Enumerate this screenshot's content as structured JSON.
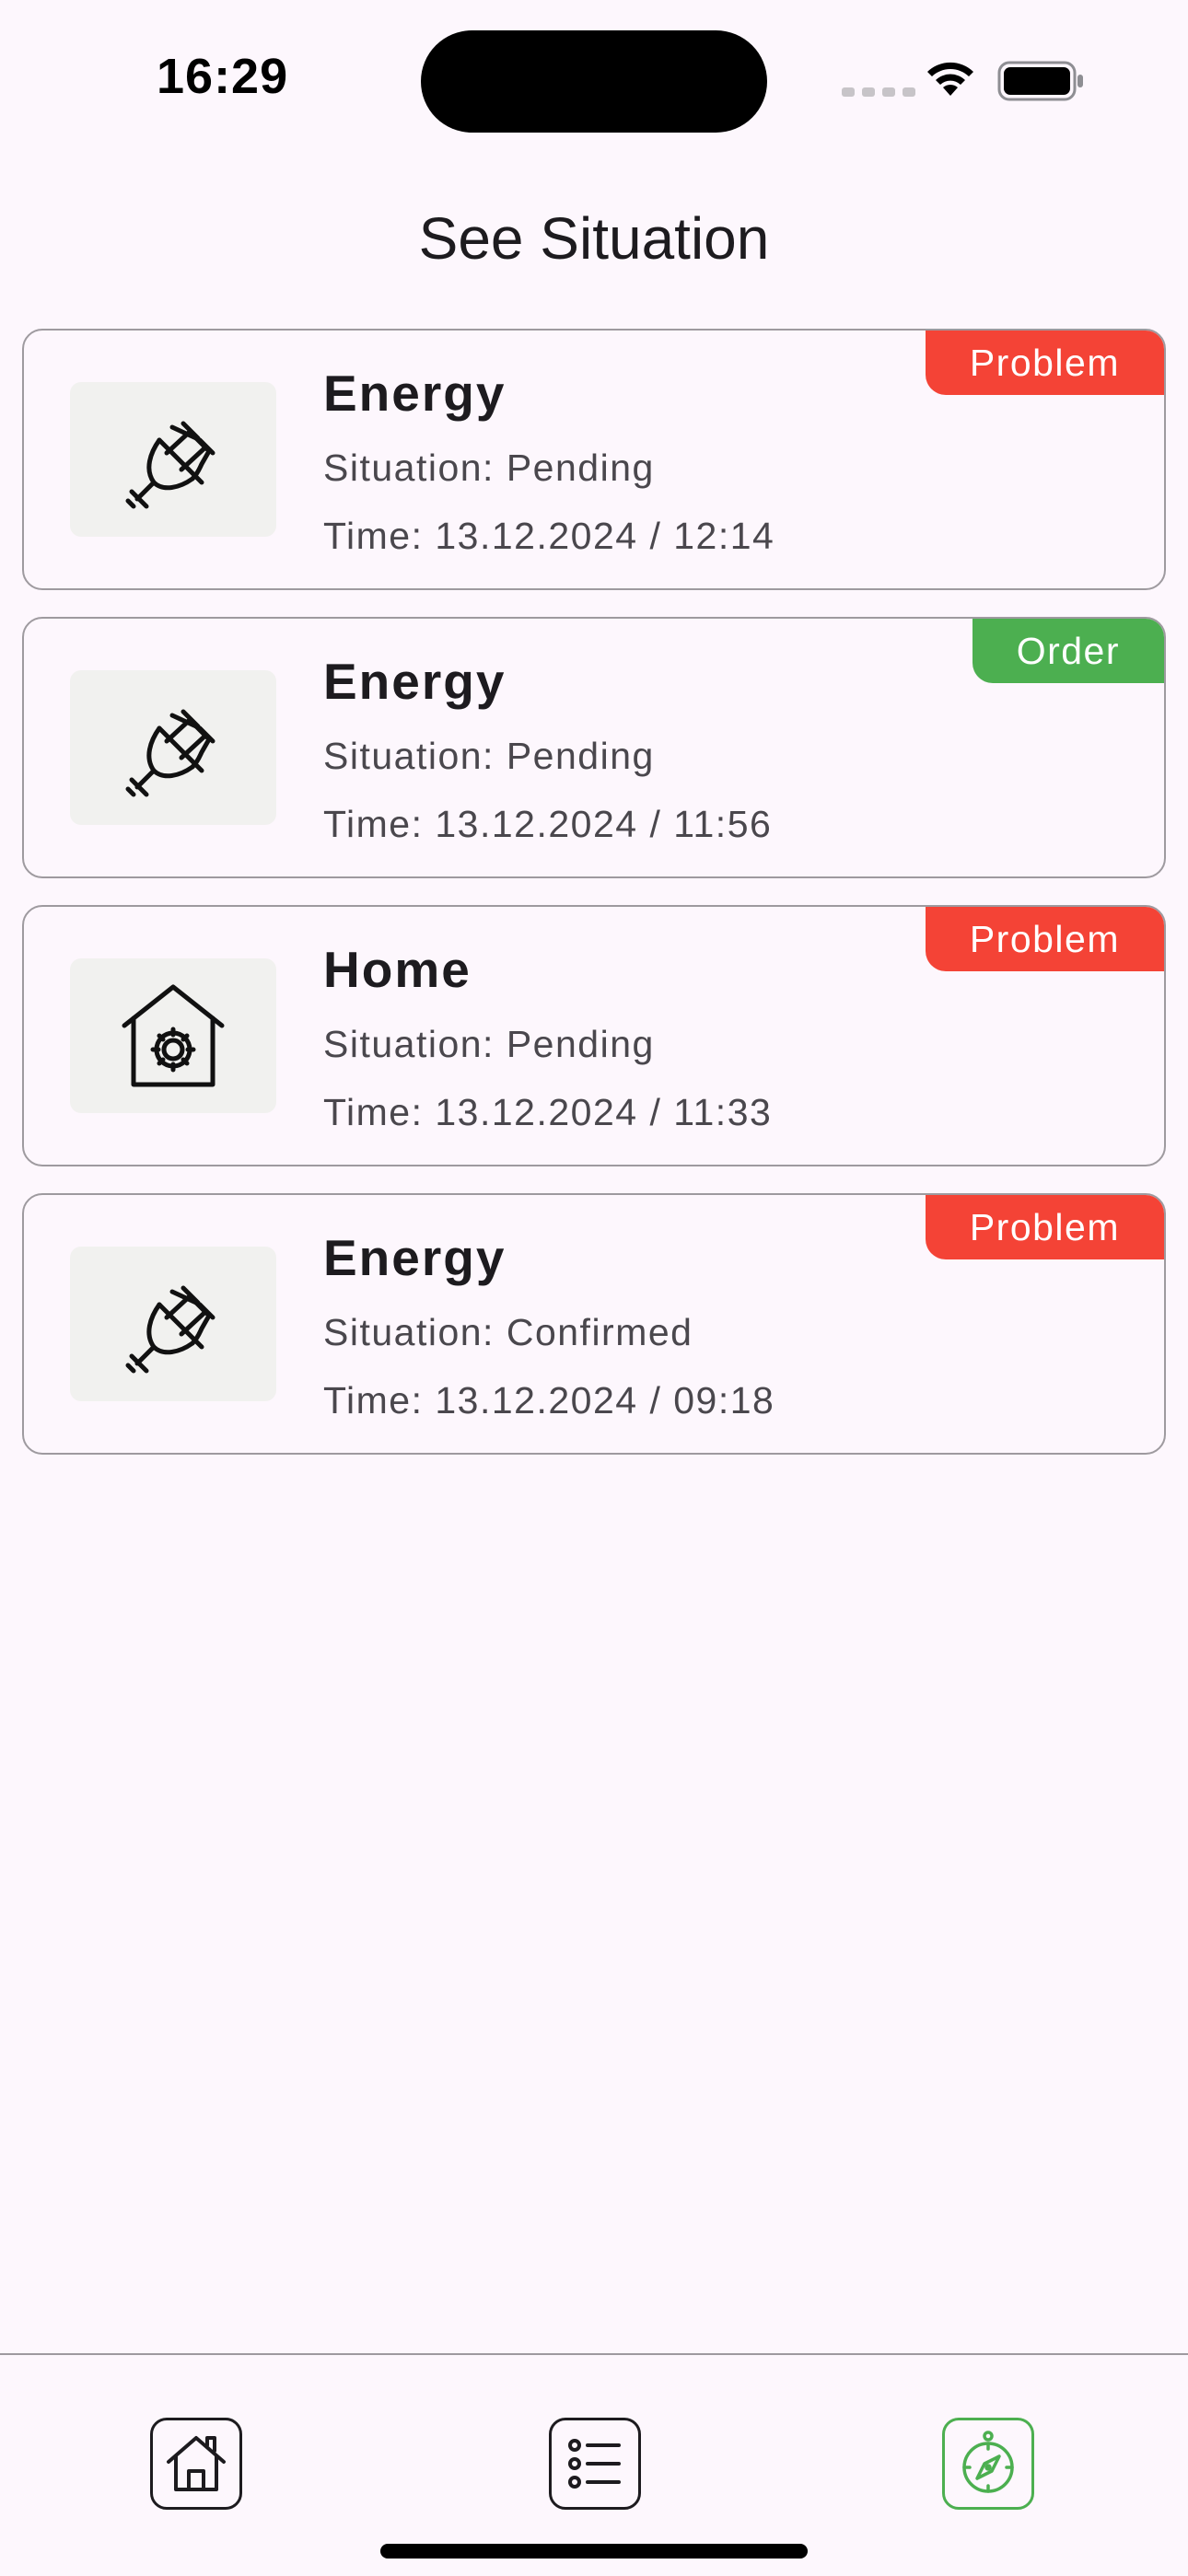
{
  "status_bar": {
    "time": "16:29"
  },
  "header": {
    "title": "See Situation"
  },
  "colors": {
    "problem": "#f44336",
    "order": "#4caf50",
    "nav_active": "#4caf50"
  },
  "cards": [
    {
      "icon": "plug-icon",
      "title": "Energy",
      "situation": "Situation: Pending",
      "time": "Time: 13.12.2024 / 12:14",
      "badge": "Problem",
      "badge_color": "#f44336"
    },
    {
      "icon": "plug-icon",
      "title": "Energy",
      "situation": "Situation: Pending",
      "time": "Time: 13.12.2024 / 11:56",
      "badge": "Order",
      "badge_color": "#4caf50"
    },
    {
      "icon": "home-settings-icon",
      "title": "Home",
      "situation": "Situation: Pending",
      "time": "Time: 13.12.2024 / 11:33",
      "badge": "Problem",
      "badge_color": "#f44336"
    },
    {
      "icon": "plug-icon",
      "title": "Energy",
      "situation": "Situation: Confirmed",
      "time": "Time: 13.12.2024 / 09:18",
      "badge": "Problem",
      "badge_color": "#f44336"
    }
  ],
  "bottom_nav": {
    "items": [
      {
        "icon": "home-icon",
        "active": false
      },
      {
        "icon": "list-icon",
        "active": false
      },
      {
        "icon": "compass-icon",
        "active": true
      }
    ]
  }
}
